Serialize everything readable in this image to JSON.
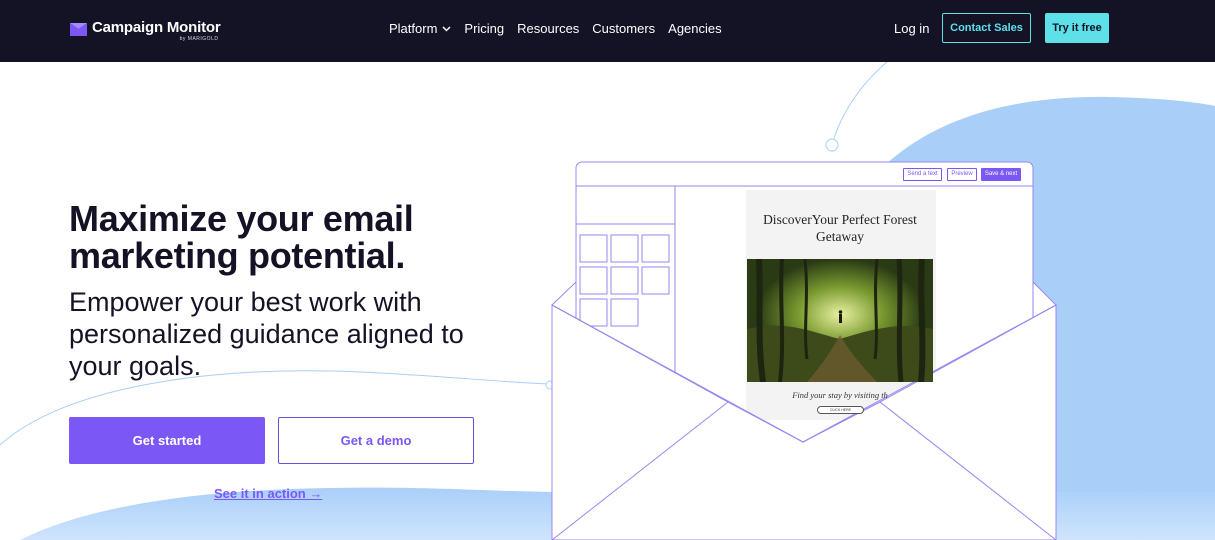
{
  "nav": {
    "logo": {
      "name": "Campaign Monitor",
      "by": "by MARIGOLD",
      "icon": "envelope-logo-icon"
    },
    "links": [
      {
        "label": "Platform",
        "has_dropdown": true
      },
      {
        "label": "Pricing"
      },
      {
        "label": "Resources"
      },
      {
        "label": "Customers"
      },
      {
        "label": "Agencies"
      }
    ],
    "login": "Log in",
    "contact": "Contact Sales",
    "try": "Try it free"
  },
  "hero": {
    "title": "Maximize your email marketing potential.",
    "subtitle": "Empower your best work with personalized guidance aligned to your goals.",
    "primary_cta": "Get started",
    "secondary_cta": "Get a demo",
    "link": "See it in action →"
  },
  "editor": {
    "buttons": [
      "Send a text",
      "Preview",
      "Save & next"
    ],
    "email_title": "DiscoverYour Perfect Forest Getaway",
    "email_caption": "Find your stay by visiting th",
    "email_cta": "CLICK HERE"
  },
  "colors": {
    "nav_bg": "#131325",
    "accent_purple": "#7b57f5",
    "accent_cyan": "#5ee0e8",
    "blob_blue": "#a9cff9"
  }
}
